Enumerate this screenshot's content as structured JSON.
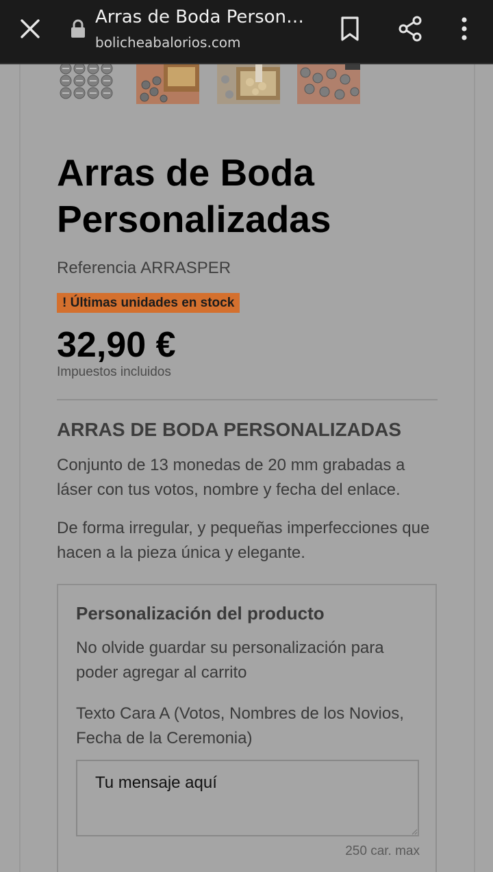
{
  "browser": {
    "title": "Arras de Boda Person…",
    "domain": "bolicheabalorios.com",
    "icons": {
      "close": "close-icon",
      "lock": "lock-icon",
      "bookmark": "bookmark-icon",
      "share": "share-icon",
      "more": "more-vertical-icon"
    },
    "bar_color": "#1b1b1b"
  },
  "product": {
    "title": "Arras de Boda Personalizadas",
    "reference_label": "Referencia",
    "reference_value": "ARRASPER",
    "stock_badge": "! Últimas unidades en stock",
    "stock_badge_color": "#d4702e",
    "price": "32,90 €",
    "tax_note": "Impuestos incluidos",
    "thumbnails": [
      "coins-thumbnail",
      "box-thumbnail",
      "tray-thumbnail",
      "coins-scatter-thumbnail"
    ]
  },
  "description": {
    "heading": "ARRAS DE BODA PERSONALIZADAS",
    "paragraph1": "Conjunto de 13 monedas de 20 mm grabadas a láser con tus votos, nombre y fecha del enlace.",
    "paragraph2": "De forma irregular, y pequeñas imperfecciones que hacen a la pieza única y elegante."
  },
  "customization": {
    "heading": "Personalización del producto",
    "note": "No olvide guardar su personalización para poder agregar al carrito",
    "field_label": "Texto Cara A (Votos, Nombres de los Novios, Fecha de la Ceremonia)",
    "field_placeholder": "Tu mensaje aquí",
    "char_limit": "250 car. max"
  }
}
